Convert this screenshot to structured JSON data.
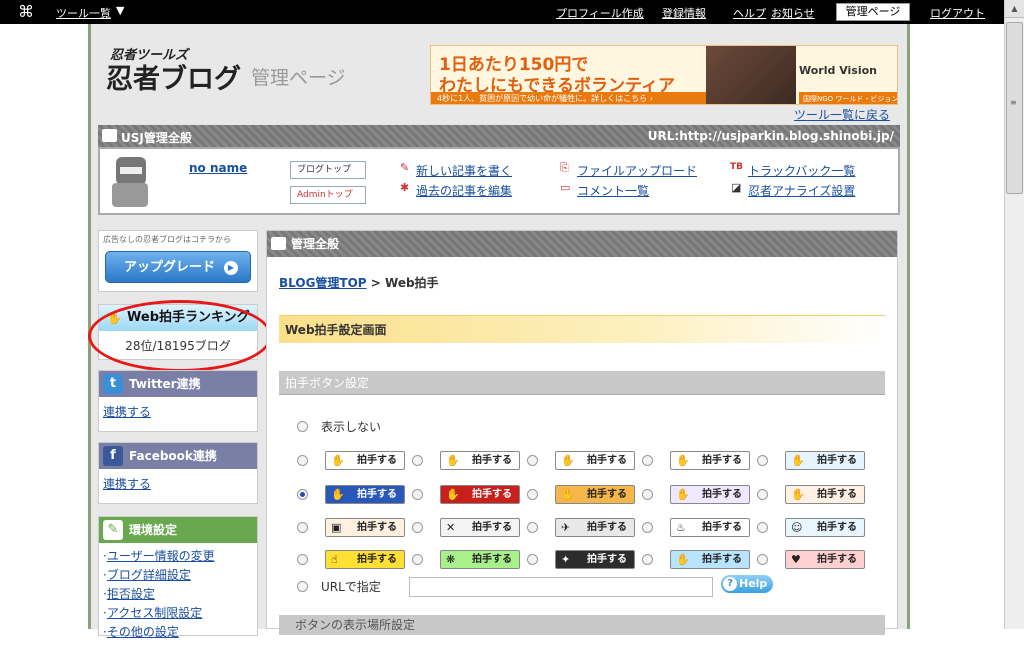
{
  "topbar": {
    "logo": "⌘",
    "tool_list": "ツール一覧",
    "tool_list_arrow": "▼",
    "profile": "プロフィール作成",
    "register": "登録情報",
    "help": "ヘルプ",
    "news": "お知らせ",
    "admin": "管理ページ",
    "logout": "ログアウト"
  },
  "header": {
    "brand_small": "忍者ツールズ",
    "brand_large": "忍者ブログ",
    "brand_sub": "管理ページ",
    "tool_list_back": "ツール一覧に戻る"
  },
  "ad": {
    "line1": "1日あたり150円で",
    "line2": "わたしにもできるボランティア",
    "bar": "4秒に1人、貧困が原因で幼い命が犠牲に。詳しくはこちら ›",
    "brand": "World Vision",
    "ngo": "国際NGO ワールド・ビジョン"
  },
  "site": {
    "title": "USJ管理全般",
    "url": "URL:http://usjparkin.blog.shinobi.jp/",
    "user": "no name"
  },
  "quick": {
    "blog_top": "ブログトップ",
    "admin_top": "Adminトップ",
    "new_post": "新しい記事を書く",
    "past_posts": "過去の記事を編集",
    "file_upload": "ファイルアップロード",
    "comments": "コメント一覧",
    "trackbacks": "トラックバック一覧",
    "analyze": "忍者アナライズ設置",
    "tb_icon_label": "TB"
  },
  "sidebar": {
    "upgrade_caption": "広告なしの忍者ブログはコチラから",
    "upgrade_label": "アップグレード",
    "ranking_title": "Web拍手ランキング",
    "ranking_value": "28位/18195ブログ",
    "twitter_title": "Twitter連携",
    "twitter_link": "連携する",
    "facebook_title": "Facebook連携",
    "facebook_link": "連携する",
    "env_title": "環境設定",
    "env_items": [
      "ユーザー情報の変更",
      "ブログ詳細設定",
      "拒否設定",
      "アクセス制限設定",
      "その他の設定"
    ]
  },
  "main": {
    "title": "管理全般",
    "crumb_link": "BLOG管理TOP",
    "crumb_rest": " > Web拍手",
    "section_title": "Web拍手設定画面",
    "button_section": "拍手ボタン設定",
    "hide_label": "表示しない",
    "clap_label": "拍手する",
    "url_label": "URLで指定",
    "url_value": "",
    "help": "Help",
    "next_section": "ボタンの表示場所設定",
    "selected_index": 5
  },
  "colors": {
    "accent": "#1a4fa0",
    "ranking": "#9ad8f4",
    "env": "#6aa84f",
    "oval": "#e81818"
  }
}
